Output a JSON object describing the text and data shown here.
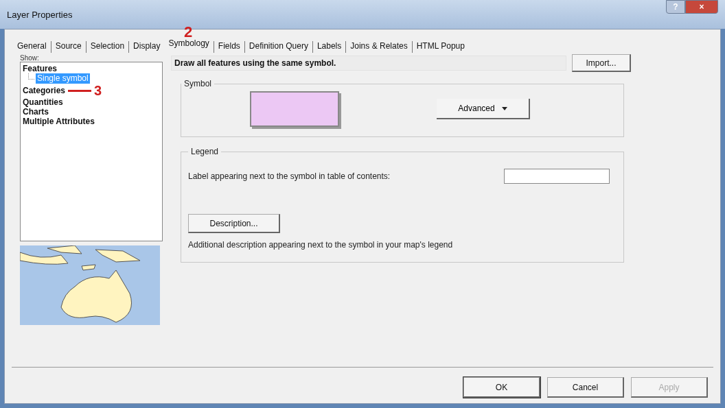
{
  "window": {
    "title": "Layer Properties",
    "controls": [
      "?",
      "×"
    ]
  },
  "tabs": [
    {
      "label": "General",
      "selected": false
    },
    {
      "label": "Source",
      "selected": false
    },
    {
      "label": "Selection",
      "selected": false
    },
    {
      "label": "Display",
      "selected": false
    },
    {
      "label": "Symbology",
      "selected": true,
      "annotation": "2"
    },
    {
      "label": "Fields",
      "selected": false
    },
    {
      "label": "Definition Query",
      "selected": false
    },
    {
      "label": "Labels",
      "selected": false
    },
    {
      "label": "Joins & Relates",
      "selected": false
    },
    {
      "label": "HTML Popup",
      "selected": false
    }
  ],
  "show": {
    "label": "Show:",
    "items": [
      {
        "label": "Features",
        "selected": false,
        "children": [
          {
            "label": "Single symbol",
            "selected": true
          }
        ]
      },
      {
        "label": "Categories",
        "selected": false,
        "annotation": "3"
      },
      {
        "label": "Quantities",
        "selected": false
      },
      {
        "label": "Charts",
        "selected": false
      },
      {
        "label": "Multiple Attributes",
        "selected": false
      }
    ]
  },
  "description": "Draw all features using the same symbol.",
  "import_button": "Import...",
  "symbol": {
    "title": "Symbol",
    "color": "#ecc8f4",
    "advanced_button": "Advanced"
  },
  "legend": {
    "title": "Legend",
    "label_prompt": "Label appearing next to the symbol in table of contents:",
    "description_button": "Description...",
    "note": "Additional description appearing next to the symbol in your map's legend"
  },
  "buttons": [
    {
      "label": "OK",
      "disabled": false,
      "default": true
    },
    {
      "label": "Cancel",
      "disabled": false,
      "default": false
    },
    {
      "label": "Apply",
      "disabled": true,
      "default": false
    }
  ]
}
